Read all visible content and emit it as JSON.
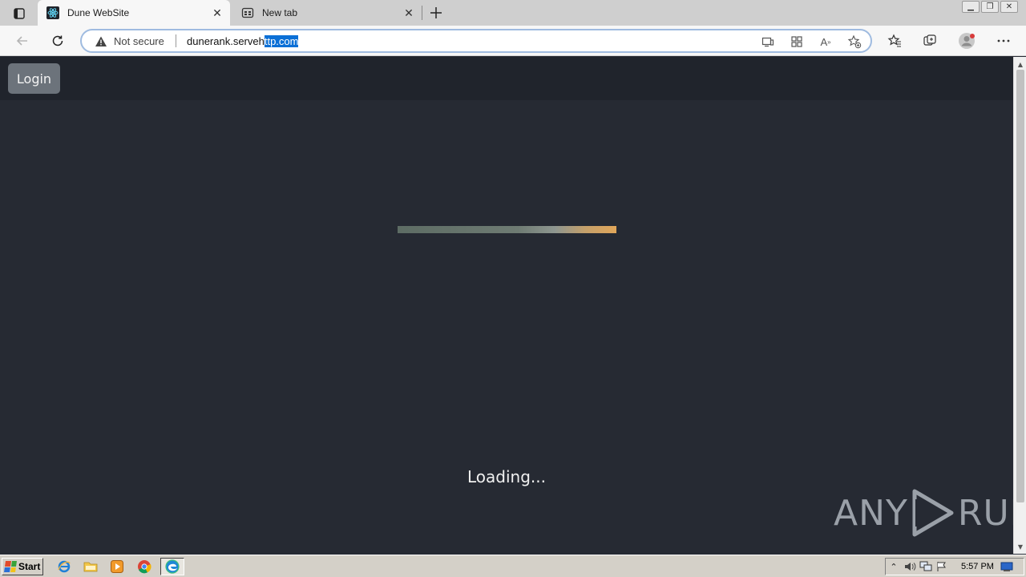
{
  "browser": {
    "tabs": [
      {
        "title": "Dune WebSite",
        "active": true
      },
      {
        "title": "New tab",
        "active": false
      }
    ],
    "address": {
      "security_label": "Not secure",
      "url_plain": "dunerank.serveh",
      "url_selected": "ttp.com"
    }
  },
  "page": {
    "login_label": "Login",
    "loading_text": "Loading...",
    "watermark": {
      "left": "ANY",
      "right": "RUN"
    }
  },
  "taskbar": {
    "start_label": "Start",
    "clock": "5:57 PM"
  },
  "colors": {
    "page_bg": "#262a33",
    "navbar_bg": "#20242c",
    "login_btn": "#6c737b",
    "selection": "#0a6fd6"
  }
}
